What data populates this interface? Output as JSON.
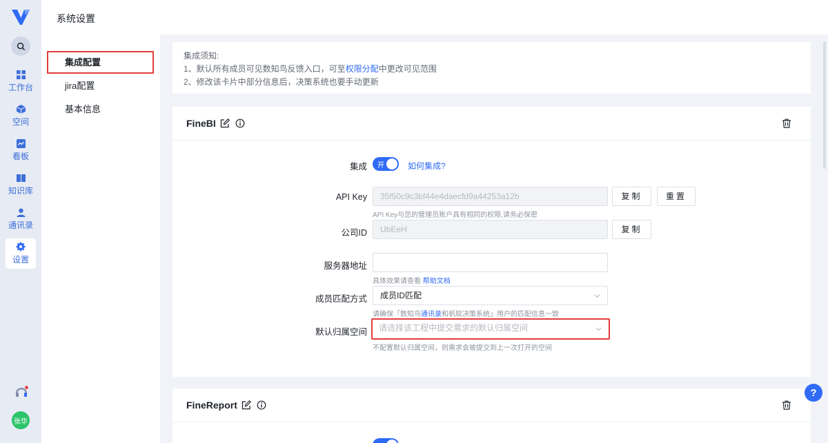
{
  "rail": {
    "items": [
      {
        "label": "工作台"
      },
      {
        "label": "空间"
      },
      {
        "label": "看板"
      },
      {
        "label": "知识库"
      },
      {
        "label": "通讯录"
      },
      {
        "label": "设置"
      }
    ],
    "active_index": 5,
    "avatar_text": "张华"
  },
  "header": {
    "title": "系统设置"
  },
  "subnav": {
    "items": [
      {
        "label": "集成配置"
      },
      {
        "label": "jira配置"
      },
      {
        "label": "基本信息"
      }
    ],
    "active_index": 0
  },
  "notice": {
    "title": "集成须知:",
    "line1_prefix": "1、默认所有成员可见数知鸟反馈入口，可至",
    "line1_link": "权限分配",
    "line1_suffix": "中更改可见范围",
    "line2": "2、修改该卡片中部分信息后，决策系统也要手动更新"
  },
  "finebi": {
    "title": "FineBI",
    "integrate_label": "集成",
    "toggle_text": "开",
    "how_link": "如何集成?",
    "api_key_label": "API Key",
    "api_key_value": "35f50c9c3bf44e4daecfd9a44253a12b",
    "copy_label": "复制",
    "reset_label": "重置",
    "api_key_hint": "API Key与您的管理员账户具有相同的权限,请务必保密",
    "company_id_label": "公司ID",
    "company_id_value": "UbEeH",
    "server_label": "服务器地址",
    "server_value": "",
    "server_hint_prefix": "具体效果请查看",
    "server_hint_link": "帮助文档",
    "match_label": "成员匹配方式",
    "match_value": "成员ID匹配",
    "match_hint_prefix": "请确保「数知鸟",
    "match_hint_link": "通讯录",
    "match_hint_suffix": "和帆软决策系统」用户的匹配信息一致",
    "space_label": "默认归属空间",
    "space_placeholder": "请选择该工程中提交需求的默认归属空间",
    "space_hint": "不配置默认归属空间，则需求会被提交到上一次打开的空间"
  },
  "finereport": {
    "title": "FineReport"
  },
  "colors": {
    "accent": "#2f6bf5",
    "highlight": "#e23b3b",
    "avatar": "#2bc46a"
  }
}
